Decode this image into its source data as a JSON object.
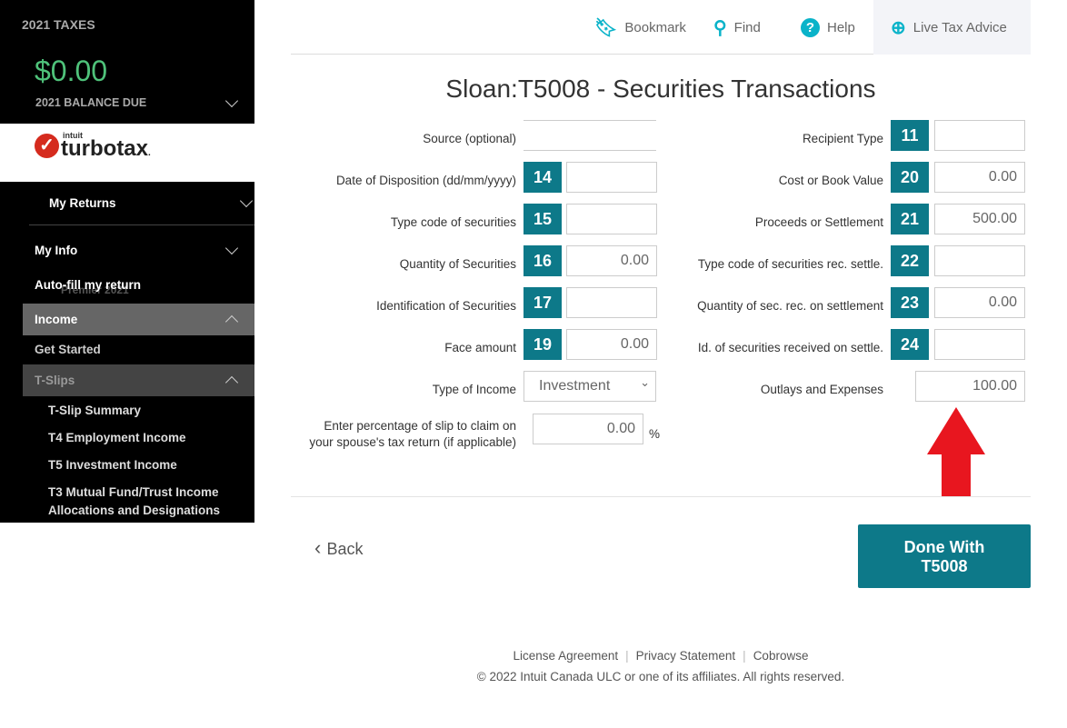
{
  "sidebar": {
    "year_label": "2021 TAXES",
    "balance": "$0.00",
    "balance_label": "2021 BALANCE DUE",
    "logo_brand": "intuit turbotax",
    "edition": "Premier 2021",
    "items": [
      {
        "label": "My Returns"
      },
      {
        "label": "My Info"
      },
      {
        "label": "Auto-fill my return"
      },
      {
        "label": "Income"
      },
      {
        "label": "Get Started"
      },
      {
        "label": "T-Slips"
      },
      {
        "label": "T-Slip Summary"
      },
      {
        "label": "T4 Employment Income"
      },
      {
        "label": "T5 Investment Income"
      },
      {
        "label": "T3 Mutual Fund/Trust Income Allocations and Designations"
      }
    ]
  },
  "topbar": {
    "bookmark": "Bookmark",
    "find": "Find",
    "help": "Help",
    "live": "Live Tax Advice"
  },
  "title": "Sloan:T5008 - Securities Transactions",
  "left_fields": [
    {
      "label": "Source (optional)",
      "box": "",
      "value": ""
    },
    {
      "label": "Date of Disposition (dd/mm/yyyy)",
      "box": "14",
      "value": ""
    },
    {
      "label": "Type code of securities",
      "box": "15",
      "value": ""
    },
    {
      "label": "Quantity of Securities",
      "box": "16",
      "value": "0.00"
    },
    {
      "label": "Identification of Securities",
      "box": "17",
      "value": ""
    },
    {
      "label": "Face amount",
      "box": "19",
      "value": "0.00"
    },
    {
      "label": "Type of Income",
      "box": "",
      "value": "Investment"
    }
  ],
  "right_fields": [
    {
      "label": "Recipient Type",
      "box": "11",
      "value": ""
    },
    {
      "label": "Cost or Book Value",
      "box": "20",
      "value": "0.00"
    },
    {
      "label": "Proceeds or Settlement",
      "box": "21",
      "value": "500.00"
    },
    {
      "label": "Type code of securities rec. settle.",
      "box": "22",
      "value": ""
    },
    {
      "label": "Quantity of sec. rec. on settlement",
      "box": "23",
      "value": "0.00"
    },
    {
      "label": "Id. of securities received on settle.",
      "box": "24",
      "value": ""
    },
    {
      "label": "Outlays and Expenses",
      "box": "",
      "value": "100.00"
    }
  ],
  "spouse": {
    "label1": "Enter percentage of slip to claim on",
    "label2": "your spouse's tax return (if applicable)",
    "value": "0.00",
    "unit": "%"
  },
  "back": "Back",
  "done1": "Done With",
  "done2": "T5008",
  "footer": {
    "license": "License Agreement",
    "privacy": "Privacy Statement",
    "cobrowse": "Cobrowse",
    "copyright": "© 2022 Intuit Canada ULC or one of its affiliates. All rights reserved."
  },
  "colors": {
    "accent": "#0d7989",
    "arrow": "#e8161f"
  }
}
